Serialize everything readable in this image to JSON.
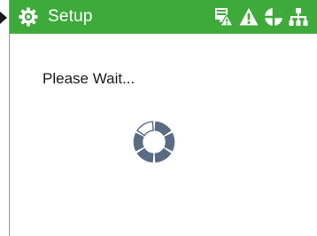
{
  "header": {
    "title": "Setup",
    "background_color": "#3daa3a",
    "icons": [
      "gear-icon",
      "controller-alarm-icon",
      "warning-icon",
      "status-indicator-icon",
      "network-icon"
    ]
  },
  "main": {
    "message": "Please Wait...",
    "spinner": {
      "segments": 6,
      "highlighted_segment": 6,
      "color": "#5a6c84"
    }
  },
  "pointer": {
    "icon": "selection-pointer-icon"
  }
}
